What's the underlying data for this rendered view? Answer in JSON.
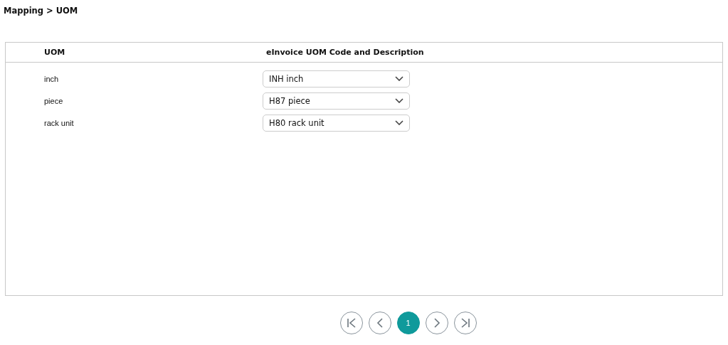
{
  "breadcrumb": "Mapping > UOM",
  "table": {
    "columns": [
      "UOM",
      "eInvoice UOM Code and Description"
    ],
    "rows": [
      {
        "uom": "inch",
        "mapping": "INH inch"
      },
      {
        "uom": "piece",
        "mapping": "H87 piece"
      },
      {
        "uom": "rack unit",
        "mapping": "H80 rack unit"
      }
    ]
  },
  "pagination": {
    "pages": [
      {
        "label": "1",
        "selected": true
      }
    ]
  }
}
